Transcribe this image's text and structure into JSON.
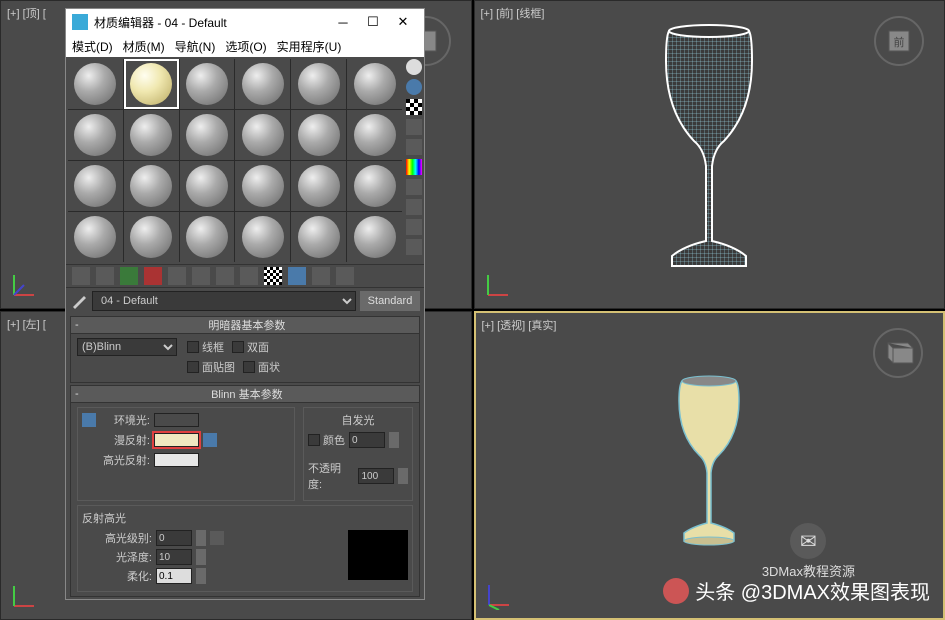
{
  "viewports": {
    "top_left": "[+] [顶] [",
    "top_right": "[+] [前] [线框]",
    "bottom_left": "[+] [左] [",
    "bottom_right": "[+] [透视] [真实]",
    "viewcube_front": "前"
  },
  "mat_editor": {
    "title": "材质编辑器 - 04 - Default",
    "menu": {
      "mode": "模式(D)",
      "material": "材质(M)",
      "navigation": "导航(N)",
      "options": "选项(O)",
      "utilities": "实用程序(U)"
    },
    "material_name": "04 - Default",
    "material_type": "Standard",
    "rollout1": {
      "title": "明暗器基本参数",
      "shader": "(B)Blinn",
      "wireframe": "线框",
      "two_sided": "双面",
      "face_map": "面贴图",
      "faceted": "面状"
    },
    "rollout2": {
      "title": "Blinn 基本参数",
      "self_illum": "自发光",
      "color_cb": "颜色",
      "self_illum_val": "0",
      "ambient": "环境光:",
      "diffuse": "漫反射:",
      "specular": "高光反射:",
      "opacity": "不透明度:",
      "opacity_val": "100",
      "reflection": "反射高光",
      "specular_level": "高光级别:",
      "specular_level_val": "0",
      "glossiness": "光泽度:",
      "glossiness_val": "10",
      "soften": "柔化:",
      "soften_val": "0.1"
    },
    "colors": {
      "ambient": "#f0e8c0",
      "diffuse": "#f0e8c0",
      "specular": "#e8e8e8"
    }
  },
  "watermark": {
    "logo_text": "3DMax教程资源",
    "bottom_text": "头条 @3DMAX效果图表现"
  }
}
